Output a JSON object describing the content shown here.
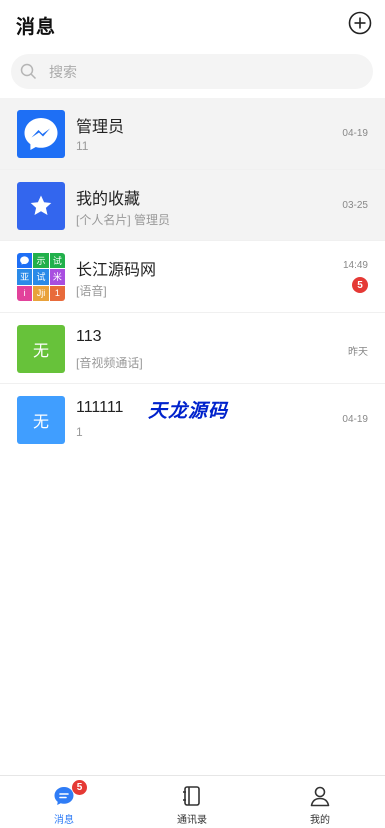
{
  "header": {
    "title": "消息"
  },
  "search": {
    "placeholder": "搜索"
  },
  "conversations": [
    {
      "name": "管理员",
      "preview": "11",
      "time": "04-19"
    },
    {
      "name": "我的收藏",
      "preview": "[个人名片] 管理员",
      "time": "03-25"
    },
    {
      "name": "长江源码网",
      "preview": "[语音]",
      "time": "14:49",
      "unread": "5",
      "avatar_cells": [
        "",
        "示",
        "试",
        "亚",
        "试",
        "米",
        "i",
        "Jji",
        "1"
      ]
    },
    {
      "name": "113",
      "preview": "[音视频通话]",
      "time": "昨天",
      "avatar_text": "无"
    },
    {
      "name": "111111",
      "preview": "1",
      "time": "04-19",
      "avatar_text": "无"
    }
  ],
  "watermark": "天龙源码",
  "tabbar": {
    "messages": {
      "label": "消息",
      "badge": "5"
    },
    "contacts": {
      "label": "通讯录"
    },
    "me": {
      "label": "我的"
    }
  },
  "colors": {
    "accent": "#2f7cf6",
    "badge": "#e53935",
    "avatar_green": "#67c23a",
    "avatar_blue": "#409eff"
  }
}
